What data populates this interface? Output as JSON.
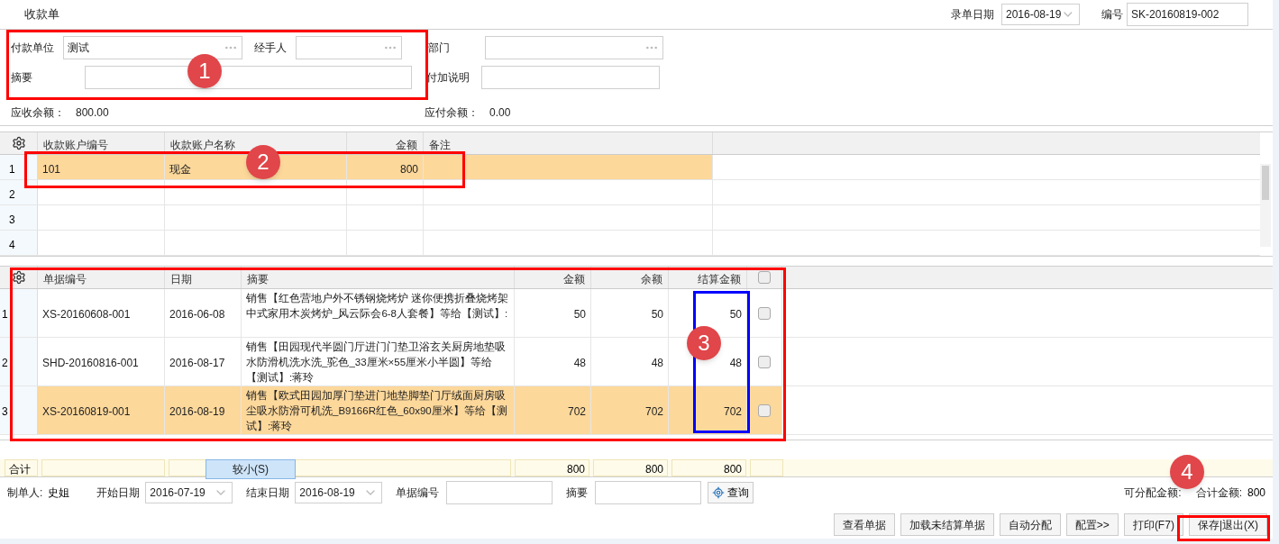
{
  "title": "收款单",
  "header": {
    "date_label": "录单日期",
    "date": "2016-08-19",
    "number_label": "编号",
    "number": "SK-20160819-002"
  },
  "form": {
    "payer_label": "付款单位",
    "payer": "测试",
    "handler_label": "经手人",
    "dept_label": "部门",
    "summary_label": "摘要",
    "note_label": "付加说明",
    "receivable_label": "应收余额：",
    "receivable": "800.00",
    "payable_label": "应付余额：",
    "payable": "0.00"
  },
  "accounts": {
    "columns": [
      "收款账户编号",
      "收款账户名称",
      "金额",
      "备注"
    ],
    "rows": [
      {
        "index": "1",
        "selected": true,
        "cells": [
          "101",
          "现金",
          "800",
          ""
        ]
      },
      {
        "index": "2",
        "selected": false,
        "cells": [
          "",
          "",
          "",
          ""
        ]
      },
      {
        "index": "3",
        "selected": false,
        "cells": [
          "",
          "",
          "",
          ""
        ]
      },
      {
        "index": "4",
        "selected": false,
        "cells": [
          "",
          "",
          "",
          ""
        ]
      }
    ]
  },
  "bills": {
    "columns": [
      "单据编号",
      "日期",
      "摘要",
      "金额",
      "余额",
      "结算金额"
    ],
    "header_checked": false,
    "rows": [
      {
        "index": "1",
        "selected": false,
        "checked": false,
        "cells": [
          "XS-20160608-001",
          "2016-06-08",
          "销售【红色营地户外不锈钢烧烤炉 迷你便携折叠烧烤架中式家用木炭烤炉_风云际会6-8人套餐】等给【测试】:",
          "50",
          "50",
          "50"
        ]
      },
      {
        "index": "2",
        "selected": false,
        "checked": false,
        "cells": [
          "SHD-20160816-001",
          "2016-08-17",
          "销售【田园现代半圆门厅进门门垫卫浴玄关厨房地垫吸水防滑机洗水洗_驼色_33厘米×55厘米小半圆】等给【测试】:蒋玲",
          "48",
          "48",
          "48"
        ]
      },
      {
        "index": "3",
        "selected": true,
        "checked": false,
        "cells": [
          "XS-20160819-001",
          "2016-08-19",
          "销售【欧式田园加厚门垫进门地垫脚垫门厅绒面厨房吸尘吸水防滑可机洗_B9166R红色_60x90厘米】等给【测试】:蒋玲",
          "702",
          "702",
          "702"
        ]
      }
    ]
  },
  "totals": {
    "label": "合计",
    "values": [
      "800",
      "800",
      "800"
    ],
    "size_button": "较小(S)"
  },
  "filter": {
    "maker_label": "制单人:",
    "maker": "史姐",
    "start_label": "开始日期",
    "start": "2016-07-19",
    "end_label": "结束日期",
    "end": "2016-08-19",
    "bill_no_label": "单据编号",
    "summary_label": "摘要",
    "query": "查询",
    "allocatable_label": "可分配金额:",
    "total_label": "合计金额:",
    "total": "800"
  },
  "buttons": [
    "查看单据",
    "加载未结算单据",
    "自动分配",
    "配置>>",
    "打印(F7)",
    "保存|退出(X)"
  ],
  "callouts": [
    {
      "label": "1"
    },
    {
      "label": "2"
    },
    {
      "label": "3"
    },
    {
      "label": "4"
    }
  ],
  "highlight_boxes": [
    {
      "color": "#ff0000"
    },
    {
      "color": "#ff0000"
    },
    {
      "color": "#ff0000"
    },
    {
      "color": "#0000ff"
    },
    {
      "color": "#ff0000"
    }
  ]
}
